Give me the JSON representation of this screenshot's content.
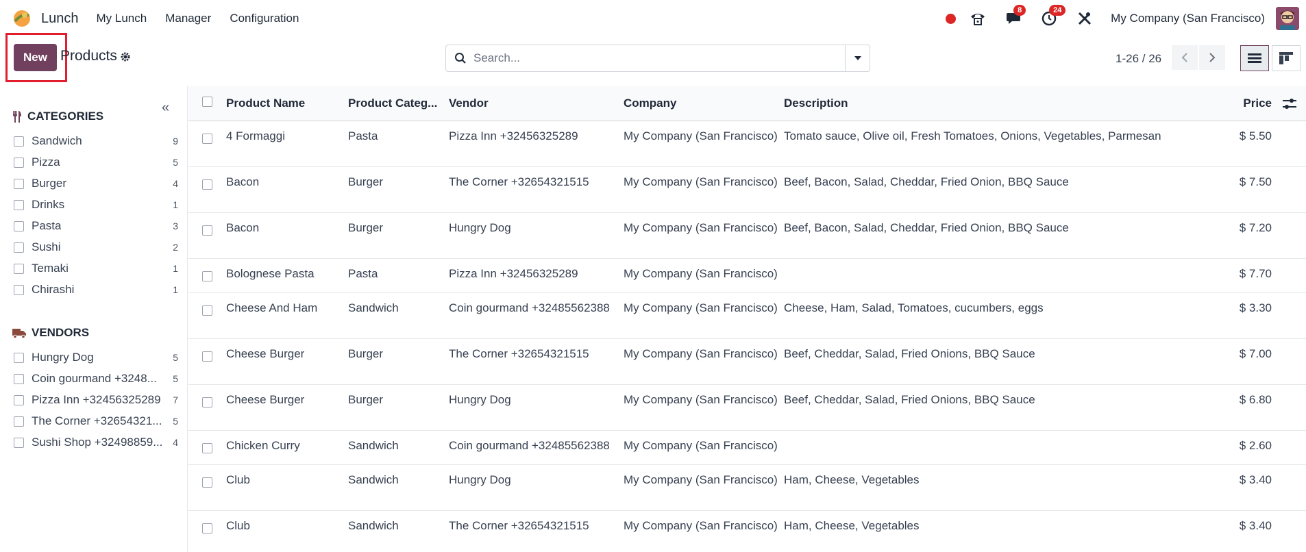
{
  "navbar": {
    "app_name": "Lunch",
    "menus": [
      "My Lunch",
      "Manager",
      "Configuration"
    ],
    "messages_count": "8",
    "activities_count": "24",
    "company": "My Company (San Francisco)"
  },
  "control": {
    "new_label": "New",
    "breadcrumb": "Products",
    "search_placeholder": "Search...",
    "pager": "1-26 / 26"
  },
  "sidebar": {
    "categories_title": "CATEGORIES",
    "categories": [
      {
        "label": "Sandwich",
        "count": "9"
      },
      {
        "label": "Pizza",
        "count": "5"
      },
      {
        "label": "Burger",
        "count": "4"
      },
      {
        "label": "Drinks",
        "count": "1"
      },
      {
        "label": "Pasta",
        "count": "3"
      },
      {
        "label": "Sushi",
        "count": "2"
      },
      {
        "label": "Temaki",
        "count": "1"
      },
      {
        "label": "Chirashi",
        "count": "1"
      }
    ],
    "vendors_title": "VENDORS",
    "vendors": [
      {
        "label": "Hungry Dog",
        "count": "5"
      },
      {
        "label": "Coin gourmand +3248...",
        "count": "5"
      },
      {
        "label": "Pizza Inn +32456325289",
        "count": "7"
      },
      {
        "label": "The Corner +32654321...",
        "count": "5"
      },
      {
        "label": "Sushi Shop +32498859...",
        "count": "4"
      }
    ]
  },
  "table": {
    "headers": {
      "name": "Product Name",
      "category": "Product Categ...",
      "vendor": "Vendor",
      "company": "Company",
      "description": "Description",
      "price": "Price"
    },
    "rows": [
      {
        "name": "4 Formaggi",
        "category": "Pasta",
        "vendor": "Pizza Inn +32456325289",
        "company": "My Company (San Francisco)",
        "description": "Tomato sauce, Olive oil, Fresh Tomatoes, Onions, Vegetables, Parmesan",
        "price": "$ 5.50"
      },
      {
        "name": "Bacon",
        "category": "Burger",
        "vendor": "The Corner +32654321515",
        "company": "My Company (San Francisco)",
        "description": "Beef, Bacon, Salad, Cheddar, Fried Onion, BBQ Sauce",
        "price": "$ 7.50"
      },
      {
        "name": "Bacon",
        "category": "Burger",
        "vendor": "Hungry Dog",
        "company": "My Company (San Francisco)",
        "description": "Beef, Bacon, Salad, Cheddar, Fried Onion, BBQ Sauce",
        "price": "$ 7.20"
      },
      {
        "name": "Bolognese Pasta",
        "category": "Pasta",
        "vendor": "Pizza Inn +32456325289",
        "company": "My Company (San Francisco)",
        "description": "",
        "price": "$ 7.70"
      },
      {
        "name": "Cheese And Ham",
        "category": "Sandwich",
        "vendor": "Coin gourmand +32485562388",
        "company": "My Company (San Francisco)",
        "description": "Cheese, Ham, Salad, Tomatoes, cucumbers, eggs",
        "price": "$ 3.30"
      },
      {
        "name": "Cheese Burger",
        "category": "Burger",
        "vendor": "The Corner +32654321515",
        "company": "My Company (San Francisco)",
        "description": "Beef, Cheddar, Salad, Fried Onions, BBQ Sauce",
        "price": "$ 7.00"
      },
      {
        "name": "Cheese Burger",
        "category": "Burger",
        "vendor": "Hungry Dog",
        "company": "My Company (San Francisco)",
        "description": "Beef, Cheddar, Salad, Fried Onions, BBQ Sauce",
        "price": "$ 6.80"
      },
      {
        "name": "Chicken Curry",
        "category": "Sandwich",
        "vendor": "Coin gourmand +32485562388",
        "company": "My Company (San Francisco)",
        "description": "",
        "price": "$ 2.60"
      },
      {
        "name": "Club",
        "category": "Sandwich",
        "vendor": "Hungry Dog",
        "company": "My Company (San Francisco)",
        "description": "Ham, Cheese, Vegetables",
        "price": "$ 3.40"
      },
      {
        "name": "Club",
        "category": "Sandwich",
        "vendor": "The Corner +32654321515",
        "company": "My Company (San Francisco)",
        "description": "Ham, Cheese, Vegetables",
        "price": "$ 3.40"
      }
    ]
  },
  "colors": {
    "primary": "#71405e",
    "highlight_frame": "#e11d2e",
    "badge": "#dc2626"
  }
}
